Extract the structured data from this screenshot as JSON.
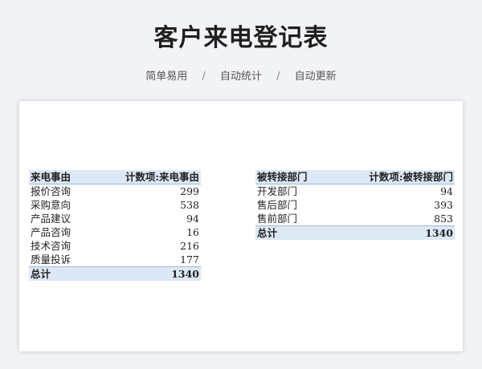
{
  "title": "客户来电登记表",
  "features": [
    "简单易用",
    "自动统计",
    "自动更新"
  ],
  "separator": "/",
  "pivot_left": {
    "header": [
      "来电事由",
      "计数项:来电事由"
    ],
    "rows": [
      {
        "label": "报价咨询",
        "value": "299"
      },
      {
        "label": "采购意向",
        "value": "538"
      },
      {
        "label": "产品建议",
        "value": "94"
      },
      {
        "label": "产品咨询",
        "value": "16"
      },
      {
        "label": "技术咨询",
        "value": "216"
      },
      {
        "label": "质量投诉",
        "value": "177"
      }
    ],
    "total": {
      "label": "总计",
      "value": "1340"
    }
  },
  "pivot_right": {
    "header": [
      "被转接部门",
      "计数项:被转接部门"
    ],
    "rows": [
      {
        "label": "开发部门",
        "value": "94"
      },
      {
        "label": "售后部门",
        "value": "393"
      },
      {
        "label": "售前部门",
        "value": "853"
      }
    ],
    "total": {
      "label": "总计",
      "value": "1340"
    }
  },
  "colors": {
    "header_fill": "#dce8f5",
    "background": "#f1f3f6"
  }
}
